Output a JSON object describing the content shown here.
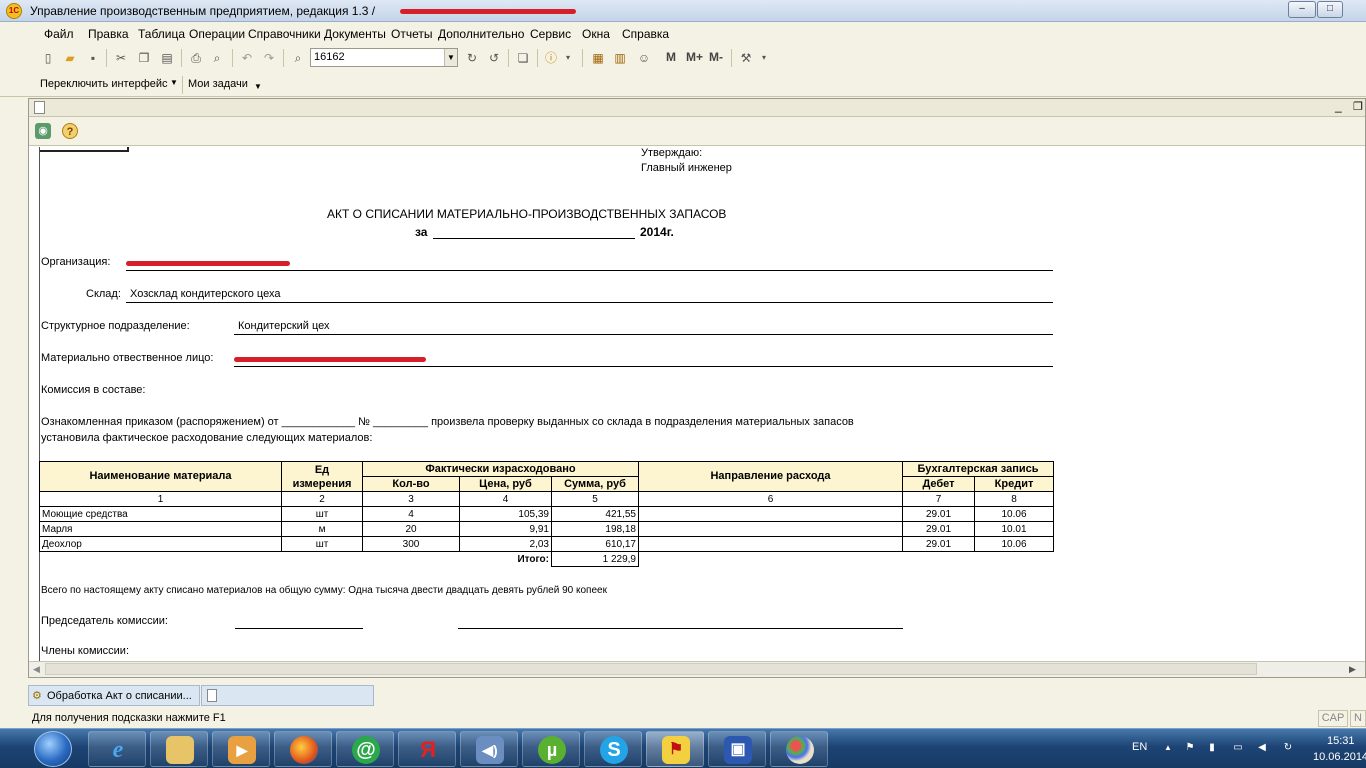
{
  "window": {
    "title": "Управление производственным предприятием, редакция 1.3 /",
    "logo_text": "1С",
    "buttons": {
      "minimize": "–",
      "maximize": "□"
    }
  },
  "menu": [
    "Файл",
    "Правка",
    "Таблица",
    "Операции",
    "Справочники",
    "Документы",
    "Отчеты",
    "Дополнительно",
    "Сервис",
    "Окна",
    "Справка"
  ],
  "toolbar": {
    "search_value": "16162",
    "memory_buttons": [
      "M",
      "M+",
      "M-"
    ],
    "icons": [
      "new-document-icon",
      "open-folder-icon",
      "save-icon",
      "cut-icon",
      "copy-icon",
      "paste-icon",
      "print-icon",
      "print-preview-icon",
      "undo-icon",
      "redo-icon",
      "search-icon",
      "find-next-icon",
      "find-prev-icon",
      "windows-icon",
      "info-icon",
      "calculator-icon",
      "calendar-icon",
      "users-icon",
      "tools-icon"
    ]
  },
  "toolbar2": {
    "switch_interface": "Переключить интерфейс",
    "my_tasks": "Мои задачи"
  },
  "document": {
    "approve": "Утверждаю:",
    "chief_engineer": "Главный инженер",
    "title": "АКТ О СПИСАНИИ МАТЕРИАЛЬНО-ПРОИЗВОДСТВЕННЫХ ЗАПАСОВ",
    "period_prefix": "за",
    "period_suffix": "2014г.",
    "org_label": "Организация:",
    "warehouse_label": "Склад:",
    "warehouse_value": "Хозсклад кондитерского цеха",
    "division_label": "Структурное подразделение:",
    "division_value": "Кондитерский цех",
    "responsible_label": "Материально отвественное лицо:",
    "commission_label": "Комиссия в составе:",
    "order_text_1": "Ознакомленная приказом (распоряжением) от ____________ № _________ произвела проверку выданных со склада в подразделения материальных запасов",
    "order_text_2": "установила фактическое расходование следующих материалов:",
    "total_text": "Всего по настоящему акту списано материалов на общую сумму: Одна тысяча двести двадцать девять рублей 90 копеек",
    "chairman_label": "Председатель комиссии:",
    "members_label": "Члены комиссии:"
  },
  "table": {
    "headers": {
      "name": "Наименование материала",
      "unit": "Ед измерения",
      "actual": "Фактически израсходовано",
      "qty": "Кол-во",
      "price": "Цена, руб",
      "sum": "Сумма, руб",
      "direction": "Направление расхода",
      "accounting": "Бухгалтерская запись",
      "debit": "Дебет",
      "credit": "Кредит"
    },
    "col_numbers": [
      "1",
      "2",
      "3",
      "4",
      "5",
      "6",
      "7",
      "8"
    ],
    "rows": [
      {
        "name": "Моющие средства",
        "unit": "шт",
        "qty": "4",
        "price": "105,39",
        "sum": "421,55",
        "direction": "",
        "debit": "29.01",
        "credit": "10.06"
      },
      {
        "name": "Марля",
        "unit": "м",
        "qty": "20",
        "price": "9,91",
        "sum": "198,18",
        "direction": "",
        "debit": "29.01",
        "credit": "10.01"
      },
      {
        "name": "Деохлор",
        "unit": "шт",
        "qty": "300",
        "price": "2,03",
        "sum": "610,17",
        "direction": "",
        "debit": "29.01",
        "credit": "10.06"
      }
    ],
    "total_label": "Итого:",
    "total_value": "1 229,9"
  },
  "tabs": [
    {
      "label": "Обработка  Акт о списании..."
    },
    {
      "label": ""
    }
  ],
  "status": {
    "hint": "Для получения подсказки нажмите F1",
    "cap": "CAP",
    "num": "N"
  },
  "taskbar": {
    "apps": [
      "ie-icon",
      "explorer-icon",
      "media-player-icon",
      "firefox-icon",
      "mail-icon",
      "yandex-icon",
      "volume-app-icon",
      "utorrent-icon",
      "skype-icon",
      "1c-icon",
      "save-disk-icon",
      "paint-icon"
    ],
    "lang": "EN",
    "time": "15:31",
    "date": "10.06.2014"
  }
}
